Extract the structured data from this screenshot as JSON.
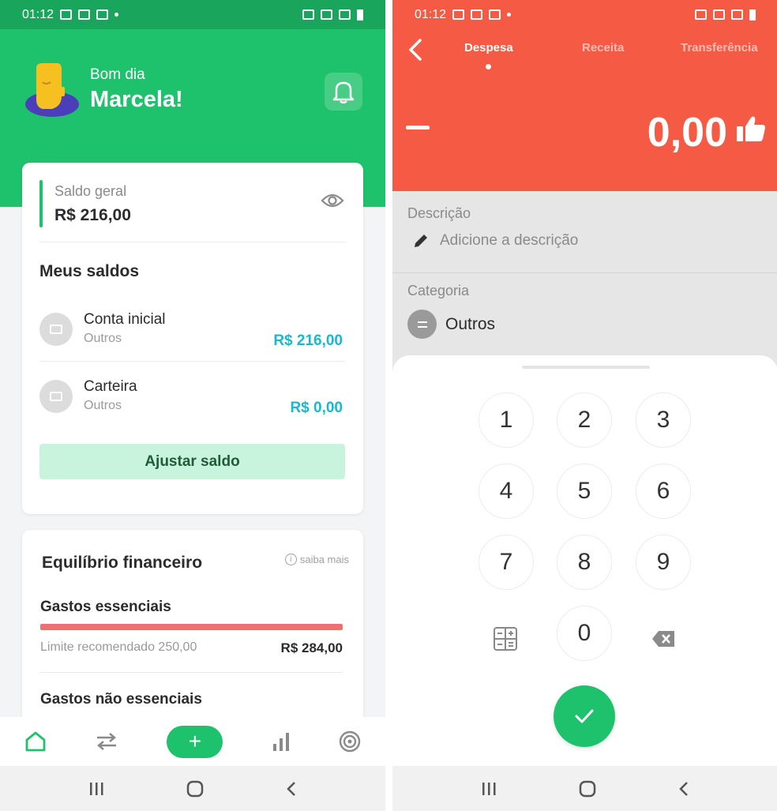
{
  "left": {
    "status": {
      "time": "01:12"
    },
    "header": {
      "greeting": "Bom dia",
      "name": "Marcela!"
    },
    "balance": {
      "label": "Saldo geral",
      "value": "R$ 216,00"
    },
    "accounts": {
      "title": "Meus saldos",
      "items": [
        {
          "name": "Conta inicial",
          "type": "Outros",
          "value": "R$ 216,00"
        },
        {
          "name": "Carteira",
          "type": "Outros",
          "value": "R$ 0,00"
        }
      ],
      "adjust_label": "Ajustar saldo"
    },
    "equilibrium": {
      "title": "Equilíbrio financeiro",
      "more_label": "saiba mais",
      "info_glyph": "i",
      "essential": {
        "title": "Gastos essenciais",
        "limit_label": "Limite recomendado 250,00",
        "value": "R$ 284,00"
      },
      "non_essential": {
        "title": "Gastos não essenciais"
      }
    },
    "nav": {
      "add_glyph": "+"
    },
    "colors": {
      "brand_green": "#1fc26c",
      "balance_blue": "#18b8cf",
      "alert_red": "#ee7070"
    }
  },
  "right": {
    "status": {
      "time": "01:12"
    },
    "tabs": [
      {
        "label": "Despesa",
        "active": true
      },
      {
        "label": "Receita",
        "active": false
      },
      {
        "label": "Transferência",
        "active": false
      }
    ],
    "amount": "0,00",
    "description": {
      "label": "Descrição",
      "placeholder": "Adicione a descrição"
    },
    "category": {
      "label": "Categoria",
      "value": "Outros"
    },
    "keypad": [
      "1",
      "2",
      "3",
      "4",
      "5",
      "6",
      "7",
      "8",
      "9",
      "0"
    ],
    "colors": {
      "expense_red": "#f55a45",
      "confirm_green": "#1fc26c"
    }
  }
}
